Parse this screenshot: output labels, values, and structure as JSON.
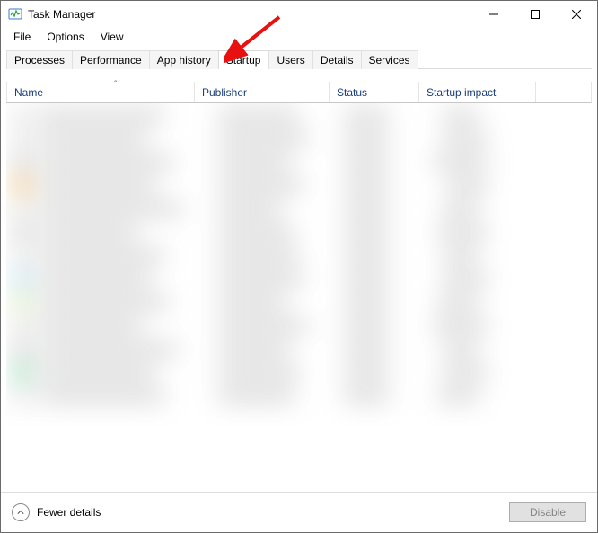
{
  "window": {
    "title": "Task Manager"
  },
  "menu": {
    "file": "File",
    "options": "Options",
    "view": "View"
  },
  "tabs": {
    "processes": "Processes",
    "performance": "Performance",
    "app_history": "App history",
    "startup": "Startup",
    "users": "Users",
    "details": "Details",
    "services": "Services"
  },
  "columns": {
    "name": "Name",
    "publisher": "Publisher",
    "status": "Status",
    "startup_impact": "Startup impact"
  },
  "footer": {
    "fewer_details": "Fewer details",
    "disable": "Disable"
  }
}
